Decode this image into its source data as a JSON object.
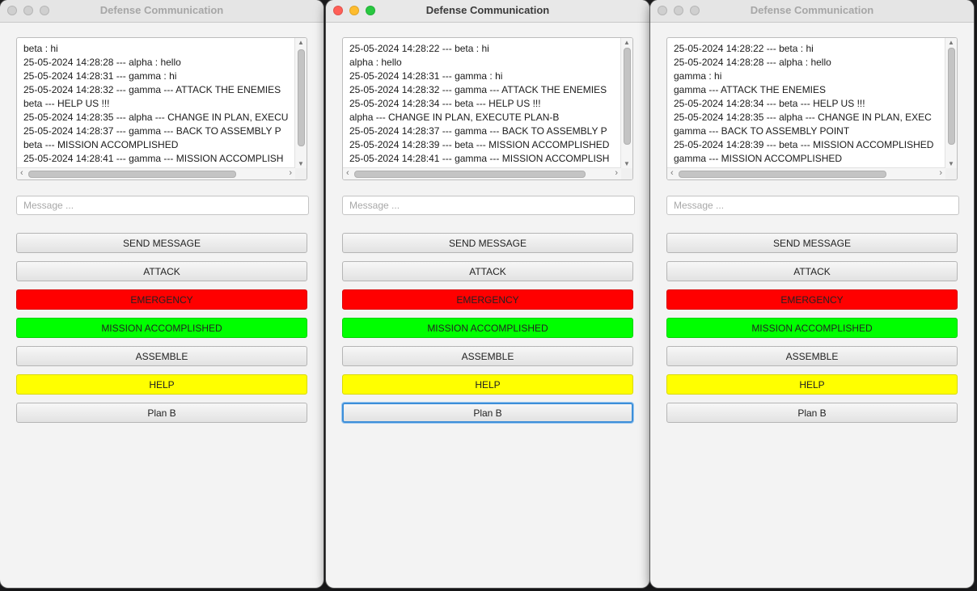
{
  "windows": [
    {
      "title": "Defense Communication",
      "active": false,
      "log_lines": [
        "beta : hi",
        "25-05-2024 14:28:28 --- alpha : hello",
        "25-05-2024 14:28:31 --- gamma : hi",
        "25-05-2024 14:28:32 --- gamma --- ATTACK THE ENEMIES",
        "beta --- HELP US !!!",
        "25-05-2024 14:28:35 --- alpha --- CHANGE IN PLAN, EXECU",
        "25-05-2024 14:28:37 --- gamma --- BACK TO ASSEMBLY P",
        "beta --- MISSION ACCOMPLISHED",
        "25-05-2024 14:28:41 --- gamma --- MISSION ACCOMPLISH"
      ],
      "message_placeholder": "Message ...",
      "buttons": {
        "send": "SEND MESSAGE",
        "attack": "ATTACK",
        "emergency": "EMERGENCY",
        "mission": "MISSION ACCOMPLISHED",
        "assemble": "ASSEMBLE",
        "help": "HELP",
        "planb": "Plan B"
      }
    },
    {
      "title": "Defense Communication",
      "active": true,
      "log_lines": [
        "25-05-2024 14:28:22 --- beta : hi",
        "alpha : hello",
        "25-05-2024 14:28:31 --- gamma : hi",
        "25-05-2024 14:28:32 --- gamma --- ATTACK THE ENEMIES",
        "25-05-2024 14:28:34 --- beta --- HELP US !!!",
        "alpha --- CHANGE IN PLAN, EXECUTE PLAN-B",
        "25-05-2024 14:28:37 --- gamma --- BACK TO ASSEMBLY P",
        "25-05-2024 14:28:39 --- beta --- MISSION ACCOMPLISHED",
        "25-05-2024 14:28:41 --- gamma --- MISSION ACCOMPLISH"
      ],
      "message_placeholder": "Message ...",
      "buttons": {
        "send": "SEND MESSAGE",
        "attack": "ATTACK",
        "emergency": "EMERGENCY",
        "mission": "MISSION ACCOMPLISHED",
        "assemble": "ASSEMBLE",
        "help": "HELP",
        "planb": "Plan B"
      }
    },
    {
      "title": "Defense Communication",
      "active": false,
      "log_lines": [
        "25-05-2024 14:28:22 --- beta : hi",
        "25-05-2024 14:28:28 --- alpha : hello",
        "gamma : hi",
        "gamma --- ATTACK THE ENEMIES",
        "25-05-2024 14:28:34 --- beta --- HELP US !!!",
        "25-05-2024 14:28:35 --- alpha --- CHANGE IN PLAN, EXEC",
        "gamma --- BACK TO ASSEMBLY POINT",
        "25-05-2024 14:28:39 --- beta --- MISSION ACCOMPLISHED",
        "gamma --- MISSION ACCOMPLISHED"
      ],
      "message_placeholder": "Message ...",
      "buttons": {
        "send": "SEND MESSAGE",
        "attack": "ATTACK",
        "emergency": "EMERGENCY",
        "mission": "MISSION ACCOMPLISHED",
        "assemble": "ASSEMBLE",
        "help": "HELP",
        "planb": "Plan B"
      }
    }
  ],
  "colors": {
    "emergency": "#ff0000",
    "mission_accomplished": "#00ff00",
    "help": "#ffff00",
    "focus_ring": "#3d8fd9"
  }
}
